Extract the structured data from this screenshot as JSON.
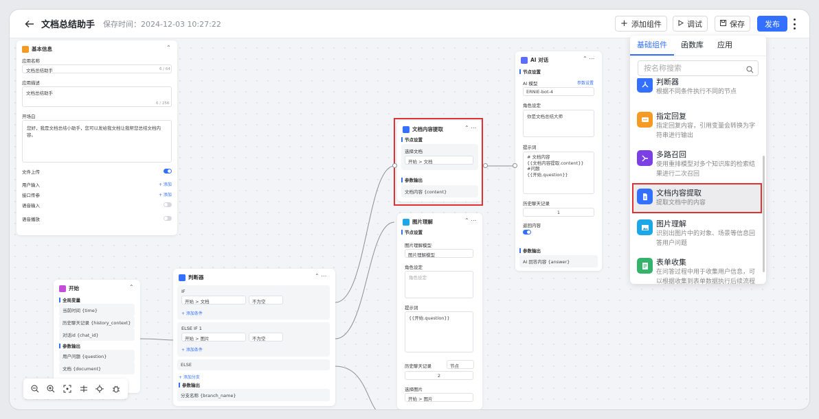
{
  "header": {
    "title": "文档总结助手",
    "save_time": "保存时间：2024-12-03 10:27:22",
    "add_component": "添加组件",
    "debug": "调试",
    "save": "保存",
    "publish": "发布"
  },
  "base_info": {
    "title": "基本信息",
    "name_label": "应用名称",
    "name_value": "文档总结助手",
    "name_count": "6 / 64",
    "desc_label": "应用描述",
    "desc_value": "文档总结助手",
    "desc_count": "6 / 256",
    "opening_label": "开场白",
    "opening_value": "您好，我是文档总结小助手，您可以发给我文档让我帮您总结文档内容。",
    "file_upload": "文件上传",
    "user_input": "用户输入",
    "api_params": "接口传参",
    "add": "+ 添加",
    "voice_input": "语音输入",
    "voice_play": "语音播放"
  },
  "start_node": {
    "title": "开始",
    "global_vars": "全局变量",
    "vars": [
      "当前时间 {time}",
      "历史聊天记录 {history_context}",
      "对话id {chat_id}"
    ],
    "output": "参数输出",
    "outputs": [
      "用户问题 {question}",
      "文档 {document}"
    ]
  },
  "judge_node": {
    "title": "判断器",
    "if_label": "IF",
    "if_field": "开始 > 文档",
    "if_cond": "不为空",
    "add_cond": "+ 添加条件",
    "elseif_label": "ELSE IF 1",
    "elseif_field": "开始 > 图片",
    "elseif_cond": "不为空",
    "else_label": "ELSE",
    "add_branch": "+ 添加分支",
    "output": "参数输出",
    "branch_name": "分支名称 {branch_name}"
  },
  "doc_node": {
    "title": "文档内容提取",
    "settings": "节点设置",
    "select_doc": "选择文档",
    "doc_value": "开始 > 文档",
    "output": "参数输出",
    "output_value": "文档内容 {content}"
  },
  "image_node": {
    "title": "图片理解",
    "settings": "节点设置",
    "model_label": "图片理解模型",
    "model_value": "图片理解模型",
    "role_label": "角色设定",
    "role_placeholder": "角色设定",
    "prompt_label": "提示词",
    "prompt_value": "{{开始.question}}",
    "history_label": "历史聊天记录",
    "history_unit": "节点",
    "history_value": "2",
    "select_image": "选择图片",
    "image_value": "开始 > 图片"
  },
  "ai_node": {
    "title": "AI 对话",
    "settings": "节点设置",
    "model_label": "AI 模型",
    "param_settings": "参数设置",
    "model_value": "ERNIE-bot-4",
    "role_label": "角色设定",
    "role_value": "你是文档总结大师",
    "prompt_label": "提示词",
    "prompt_lines": [
      "# 文档内容",
      "{{文档内容提取.content}}",
      "#问题",
      "{{开始.question}}"
    ],
    "history_label": "历史聊天记录",
    "history_value": "1",
    "return_label": "返回内容",
    "output": "参数输出",
    "output_value": "AI 回答内容 {answer}"
  },
  "panel": {
    "tabs": [
      "基础组件",
      "函数库",
      "应用"
    ],
    "search_placeholder": "按名称搜索",
    "items": [
      {
        "name": "判断器",
        "desc": "根据不同条件执行不同的节点",
        "color": "#3370ff",
        "icon": "branch-icon"
      },
      {
        "name": "指定回复",
        "desc": "指定回复内容，引用变量会转换为字符串进行输出",
        "color": "#f59a23",
        "icon": "chat-icon"
      },
      {
        "name": "多路召回",
        "desc": "使用重排模型对多个知识库的检索结果进行二次召回",
        "color": "#7b3fe4",
        "icon": "merge-icon"
      },
      {
        "name": "文档内容提取",
        "desc": "提取文档中的内容",
        "color": "#3370ff",
        "icon": "document-icon"
      },
      {
        "name": "图片理解",
        "desc": "识别出图片中的对象、场景等信息回答用户问题",
        "color": "#1ea7e6",
        "icon": "image-icon"
      },
      {
        "name": "表单收集",
        "desc": "在问答过程中用于收集用户信息，可以根据收集到表单数据执行后续流程",
        "color": "#34b36b",
        "icon": "form-icon"
      }
    ]
  }
}
